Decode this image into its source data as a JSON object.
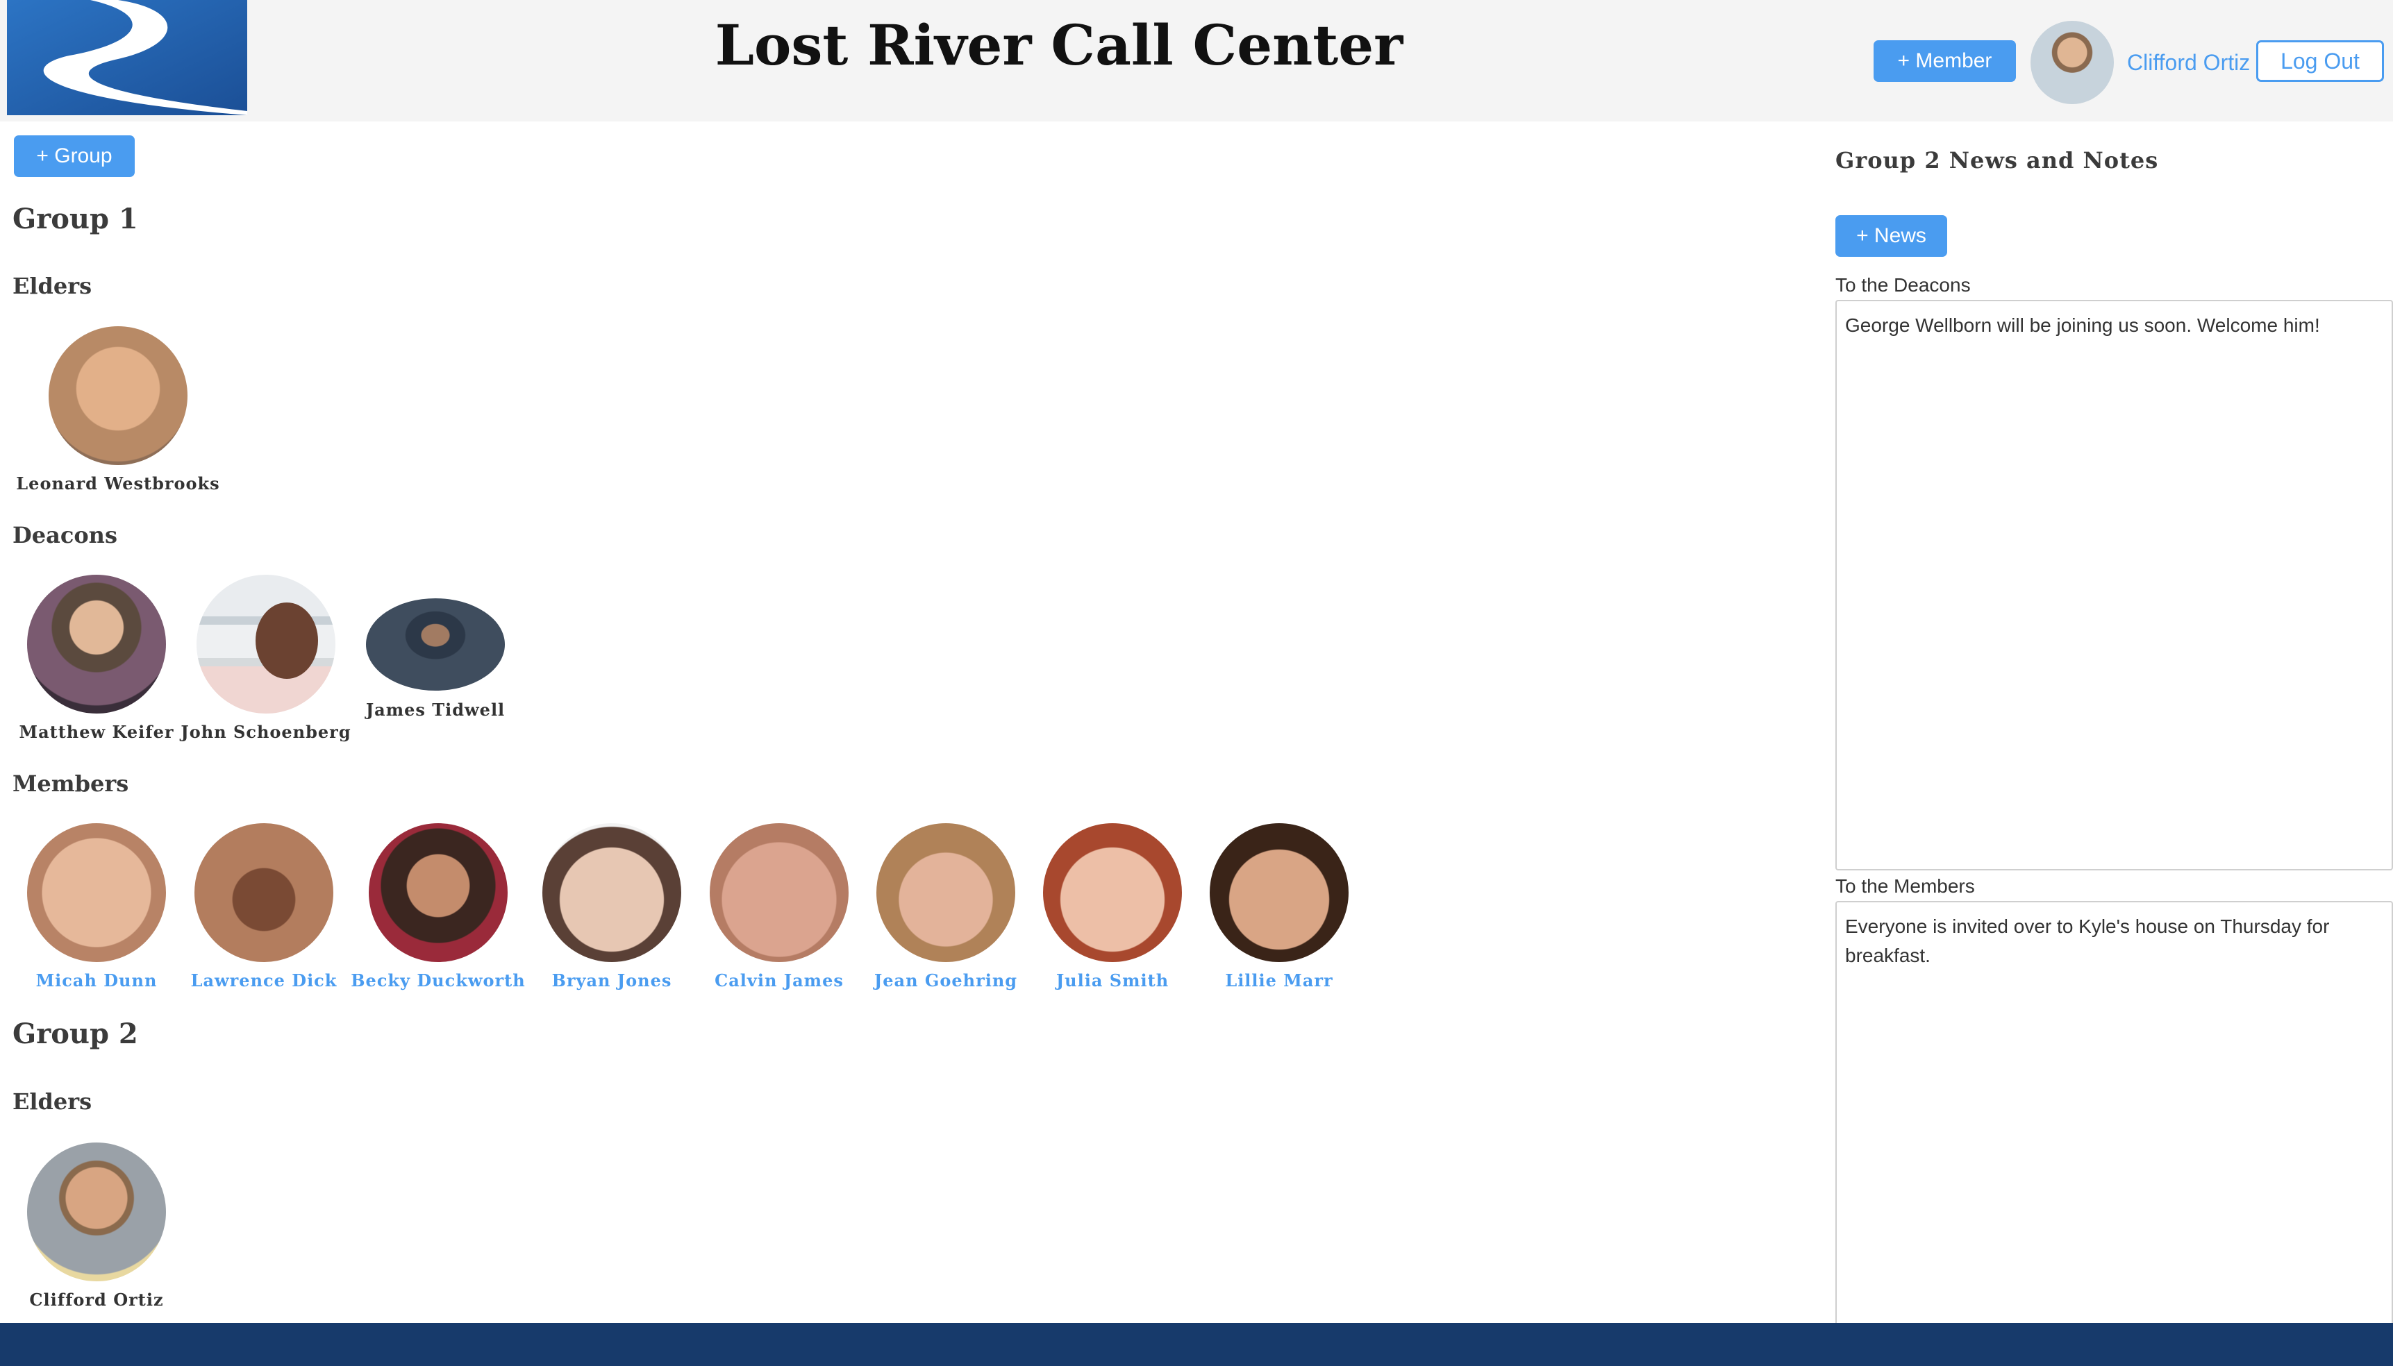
{
  "header": {
    "title": "Lost River Call Center",
    "add_member_label": "+ Member",
    "user_name": "Clifford Ortiz",
    "logout_label": "Log Out"
  },
  "main": {
    "add_group_label": "+ Group",
    "groups": [
      {
        "title": "Group 1",
        "roles": [
          {
            "title": "Elders",
            "people": [
              "Leonard Westbrooks"
            ]
          },
          {
            "title": "Deacons",
            "people": [
              "Matthew Keifer",
              "John Schoenberg",
              "James Tidwell"
            ]
          },
          {
            "title": "Members",
            "people": [
              "Micah Dunn",
              "Lawrence Dick",
              "Becky Duckworth",
              "Bryan Jones",
              "Calvin James",
              "Jean Goehring",
              "Julia Smith",
              "Lillie Marr"
            ]
          }
        ]
      },
      {
        "title": "Group 2",
        "roles": [
          {
            "title": "Elders",
            "people": [
              "Clifford Ortiz"
            ]
          }
        ]
      }
    ]
  },
  "news_panel": {
    "title": "Group 2 News and Notes",
    "add_news_label": "+ News",
    "deacons_label": "To the Deacons",
    "deacons_note": "George Wellborn will be joining us soon. Welcome him!",
    "members_label": "To the Members",
    "members_note": "Everyone is invited over to Kyle's house on Thursday for breakfast."
  },
  "colors": {
    "accent": "#4a9cf0",
    "header_bg": "#f4f4f4",
    "footer_bg": "#173a6b",
    "logo_bg": "#1f5fae"
  },
  "icons": {
    "logo": "river-logo"
  }
}
